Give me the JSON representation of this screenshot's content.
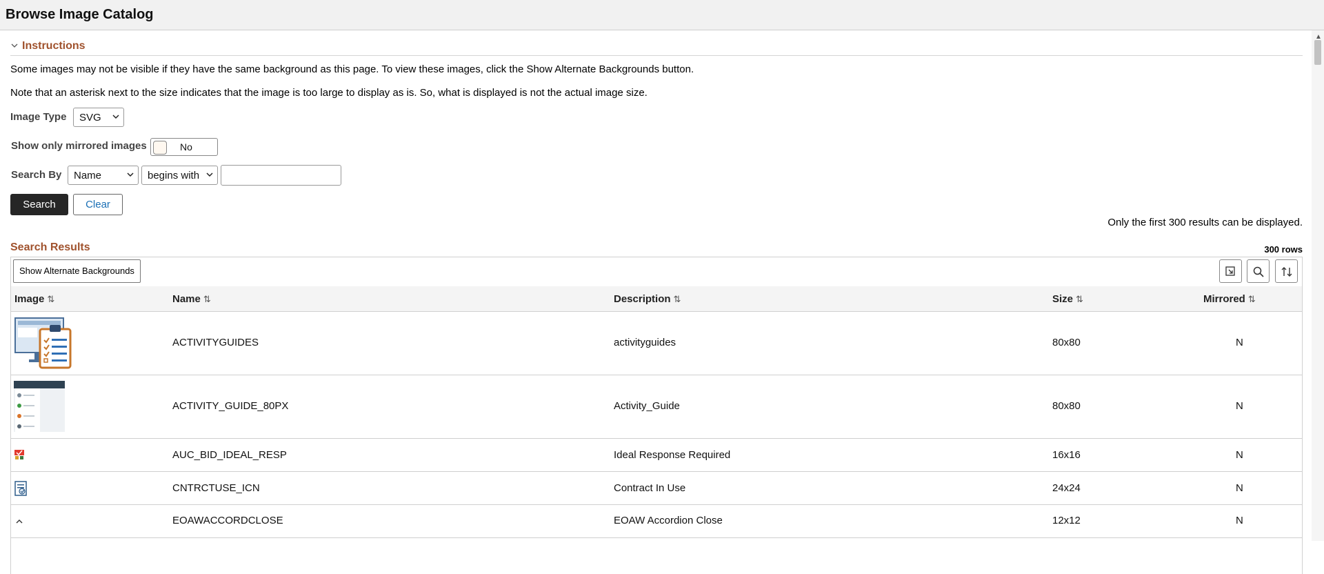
{
  "window": {
    "title": "Browse Image Catalog"
  },
  "instructions": {
    "heading": "Instructions",
    "text1": "Some images may not be visible if they have the same background as this page. To view these images, click the Show Alternate Backgrounds button.",
    "text2": "Note that an asterisk next to the size indicates that the image is too large to display as is. So, what is displayed is not the actual image size."
  },
  "filters": {
    "image_type_label": "Image Type",
    "image_type_value": "SVG",
    "mirrored_label": "Show only mirrored images",
    "mirrored_value": "No",
    "search_by_label": "Search By",
    "search_by_field": "Name",
    "search_by_operator": "begins with",
    "search_text": ""
  },
  "buttons": {
    "search": "Search",
    "clear": "Clear"
  },
  "results": {
    "limit_note": "Only the first 300 results can be displayed.",
    "heading": "Search Results",
    "row_count": "300 rows",
    "alt_bg_button": "Show Alternate Backgrounds",
    "columns": {
      "image": "Image",
      "name": "Name",
      "description": "Description",
      "size": "Size",
      "mirrored": "Mirrored"
    },
    "rows": [
      {
        "image": "clipboard-checklist-icon",
        "name": "ACTIVITYGUIDES",
        "description": "activityguides",
        "size": "80x80",
        "mirrored": "N"
      },
      {
        "image": "activity-guide-list-icon",
        "name": "ACTIVITY_GUIDE_80PX",
        "description": "Activity_Guide",
        "size": "80x80",
        "mirrored": "N"
      },
      {
        "image": "ideal-response-icon",
        "name": "AUC_BID_IDEAL_RESP",
        "description": "Ideal Response Required",
        "size": "16x16",
        "mirrored": "N"
      },
      {
        "image": "contract-in-use-icon",
        "name": "CNTRCTUSE_ICN",
        "description": "Contract  In Use",
        "size": "24x24",
        "mirrored": "N"
      },
      {
        "image": "chevron-up-icon",
        "name": "EOAWACCORDCLOSE",
        "description": "EOAW Accordion Close",
        "size": "12x12",
        "mirrored": "N"
      }
    ]
  },
  "colors": {
    "accent": "#a0522d",
    "link": "#1a6fb5",
    "dark_button": "#262626"
  }
}
